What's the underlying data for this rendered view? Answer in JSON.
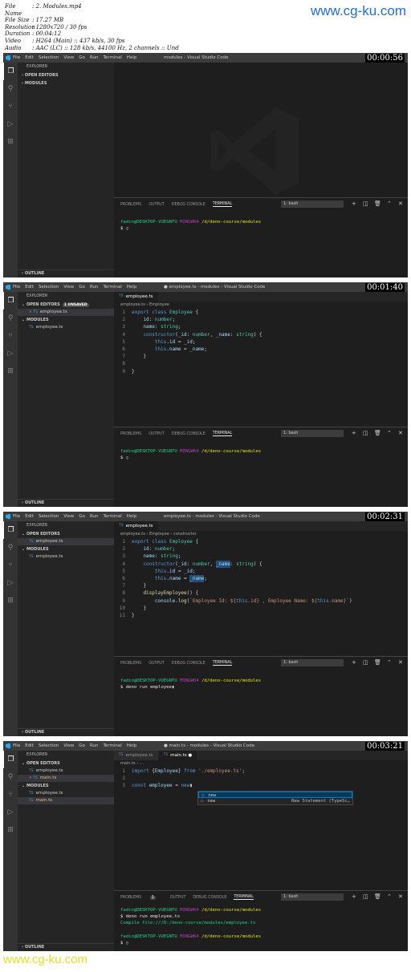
{
  "header": {
    "file_name_label": "File Name",
    "file_name": "2. Modules.mp4",
    "file_size_label": "File Size",
    "file_size": "17.27 MB",
    "resolution_label": "Resolution",
    "resolution": "1280x720 / 30 fps",
    "duration_label": "Duration",
    "duration": "00:04:12",
    "video_label": "Video",
    "video": "H264 (Main) :: 437 kb/s, 30 fps",
    "audio_label": "Audio",
    "audio": "AAC (LC) :: 128 kb/s, 44100 Hz, 2 channels :: Und",
    "watermark": "www.cg-ku.com"
  },
  "footer_watermark": "www.cg-ku.com",
  "menu": [
    "File",
    "Edit",
    "Selection",
    "View",
    "Go",
    "Run",
    "Terminal",
    "Help"
  ],
  "panel_tabs": {
    "problems": "PROBLEMS",
    "output": "OUTPUT",
    "debug": "DEBUG CONSOLE",
    "terminal": "TERMINAL",
    "shell": "1: bash"
  },
  "sidebar_labels": {
    "explorer": "EXPLORER",
    "open_editors": "OPEN EDITORS",
    "modules": "MODULES",
    "outline": "OUTLINE",
    "unsaved": "1 UNSAVED"
  },
  "prompt": {
    "user": "fadin@DESKTOP-VUEGNTU",
    "env": "MINGW64",
    "path": "/d/deno-course/modules",
    "dollar": "$"
  },
  "frames": [
    {
      "title": "modules - Visual Studio Code",
      "timestamp": "00:00:56"
    },
    {
      "title": "● employee.ts - modules - Visual Studio Code",
      "timestamp": "00:01:40",
      "tab": "employee.ts",
      "breadcrumb_file": "employee.ts",
      "breadcrumb_symbol": "Employee",
      "file": "employee.ts"
    },
    {
      "title": "employee.ts - modules - Visual Studio Code",
      "timestamp": "00:02:31",
      "tab": "employee.ts",
      "breadcrumb_file": "employee.ts",
      "breadcrumb_symbol": "Employee",
      "breadcrumb_symbol2": "constructor",
      "file": "employee.ts",
      "cmd": "deno run employee"
    },
    {
      "title": "● main.ts - modules - Visual Studio Code",
      "timestamp": "00:03:21",
      "tab1": "employee.ts",
      "tab2": "main.ts",
      "breadcrumb_file": "main.ts",
      "file1": "employee.ts",
      "file2": "main.ts",
      "badge": "1",
      "cmd": "deno run employee.ts",
      "compile": "Compile file:///D:/deno-course/modules/employee.ts",
      "ac_item1": "new",
      "ac_item2": "new",
      "ac_detail": "New Statement (TypeSc…"
    }
  ]
}
